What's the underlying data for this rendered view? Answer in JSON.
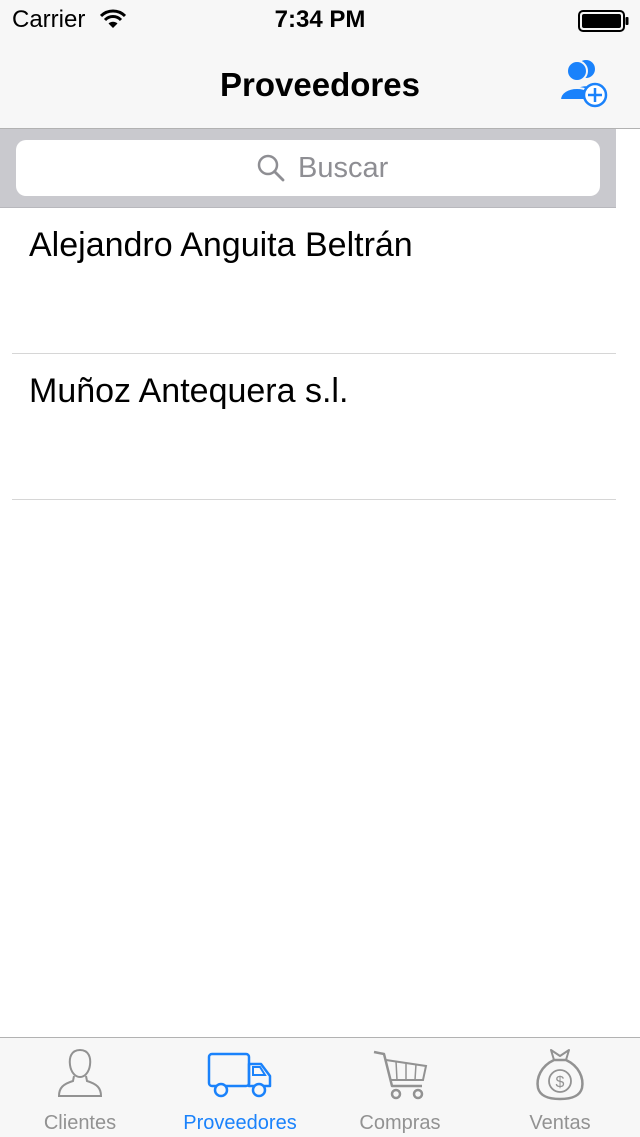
{
  "status_bar": {
    "carrier": "Carrier",
    "time": "7:34 PM",
    "icons": [
      "wifi-icon",
      "battery-icon"
    ]
  },
  "nav": {
    "title": "Proveedores",
    "add_button_icon": "add-contact-icon"
  },
  "search": {
    "placeholder": "Buscar",
    "value": ""
  },
  "providers": [
    {
      "name": "Alejandro Anguita Beltrán"
    },
    {
      "name": "Muñoz Antequera s.l."
    }
  ],
  "tabs": [
    {
      "label": "Clientes",
      "icon": "person-icon",
      "active": false
    },
    {
      "label": "Proveedores",
      "icon": "truck-icon",
      "active": true
    },
    {
      "label": "Compras",
      "icon": "cart-icon",
      "active": false
    },
    {
      "label": "Ventas",
      "icon": "money-bag-icon",
      "active": false
    }
  ],
  "colors": {
    "accent": "#1a82fb",
    "inactive": "#929292",
    "bar_bg": "#f7f7f7",
    "search_bar_bg": "#c9c9ce"
  }
}
